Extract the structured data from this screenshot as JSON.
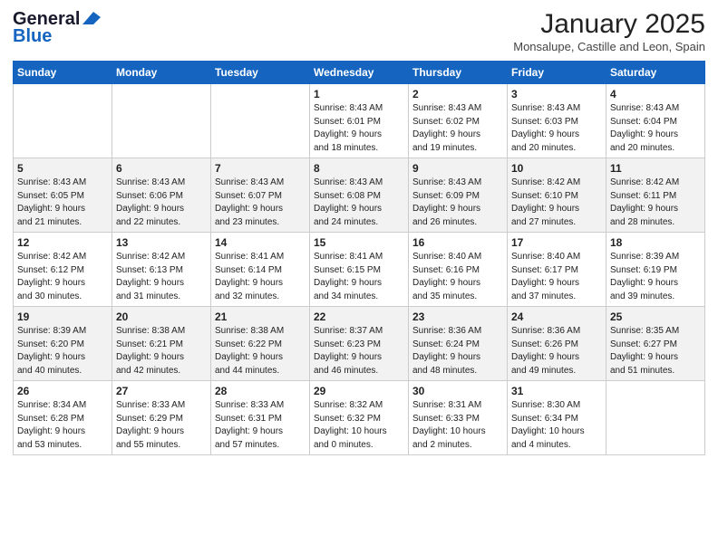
{
  "header": {
    "logo_line1": "General",
    "logo_line2": "Blue",
    "month_year": "January 2025",
    "location": "Monsalupe, Castille and Leon, Spain"
  },
  "days_of_week": [
    "Sunday",
    "Monday",
    "Tuesday",
    "Wednesday",
    "Thursday",
    "Friday",
    "Saturday"
  ],
  "weeks": [
    [
      {
        "day": "",
        "info": ""
      },
      {
        "day": "",
        "info": ""
      },
      {
        "day": "",
        "info": ""
      },
      {
        "day": "1",
        "info": "Sunrise: 8:43 AM\nSunset: 6:01 PM\nDaylight: 9 hours\nand 18 minutes."
      },
      {
        "day": "2",
        "info": "Sunrise: 8:43 AM\nSunset: 6:02 PM\nDaylight: 9 hours\nand 19 minutes."
      },
      {
        "day": "3",
        "info": "Sunrise: 8:43 AM\nSunset: 6:03 PM\nDaylight: 9 hours\nand 20 minutes."
      },
      {
        "day": "4",
        "info": "Sunrise: 8:43 AM\nSunset: 6:04 PM\nDaylight: 9 hours\nand 20 minutes."
      }
    ],
    [
      {
        "day": "5",
        "info": "Sunrise: 8:43 AM\nSunset: 6:05 PM\nDaylight: 9 hours\nand 21 minutes."
      },
      {
        "day": "6",
        "info": "Sunrise: 8:43 AM\nSunset: 6:06 PM\nDaylight: 9 hours\nand 22 minutes."
      },
      {
        "day": "7",
        "info": "Sunrise: 8:43 AM\nSunset: 6:07 PM\nDaylight: 9 hours\nand 23 minutes."
      },
      {
        "day": "8",
        "info": "Sunrise: 8:43 AM\nSunset: 6:08 PM\nDaylight: 9 hours\nand 24 minutes."
      },
      {
        "day": "9",
        "info": "Sunrise: 8:43 AM\nSunset: 6:09 PM\nDaylight: 9 hours\nand 26 minutes."
      },
      {
        "day": "10",
        "info": "Sunrise: 8:42 AM\nSunset: 6:10 PM\nDaylight: 9 hours\nand 27 minutes."
      },
      {
        "day": "11",
        "info": "Sunrise: 8:42 AM\nSunset: 6:11 PM\nDaylight: 9 hours\nand 28 minutes."
      }
    ],
    [
      {
        "day": "12",
        "info": "Sunrise: 8:42 AM\nSunset: 6:12 PM\nDaylight: 9 hours\nand 30 minutes."
      },
      {
        "day": "13",
        "info": "Sunrise: 8:42 AM\nSunset: 6:13 PM\nDaylight: 9 hours\nand 31 minutes."
      },
      {
        "day": "14",
        "info": "Sunrise: 8:41 AM\nSunset: 6:14 PM\nDaylight: 9 hours\nand 32 minutes."
      },
      {
        "day": "15",
        "info": "Sunrise: 8:41 AM\nSunset: 6:15 PM\nDaylight: 9 hours\nand 34 minutes."
      },
      {
        "day": "16",
        "info": "Sunrise: 8:40 AM\nSunset: 6:16 PM\nDaylight: 9 hours\nand 35 minutes."
      },
      {
        "day": "17",
        "info": "Sunrise: 8:40 AM\nSunset: 6:17 PM\nDaylight: 9 hours\nand 37 minutes."
      },
      {
        "day": "18",
        "info": "Sunrise: 8:39 AM\nSunset: 6:19 PM\nDaylight: 9 hours\nand 39 minutes."
      }
    ],
    [
      {
        "day": "19",
        "info": "Sunrise: 8:39 AM\nSunset: 6:20 PM\nDaylight: 9 hours\nand 40 minutes."
      },
      {
        "day": "20",
        "info": "Sunrise: 8:38 AM\nSunset: 6:21 PM\nDaylight: 9 hours\nand 42 minutes."
      },
      {
        "day": "21",
        "info": "Sunrise: 8:38 AM\nSunset: 6:22 PM\nDaylight: 9 hours\nand 44 minutes."
      },
      {
        "day": "22",
        "info": "Sunrise: 8:37 AM\nSunset: 6:23 PM\nDaylight: 9 hours\nand 46 minutes."
      },
      {
        "day": "23",
        "info": "Sunrise: 8:36 AM\nSunset: 6:24 PM\nDaylight: 9 hours\nand 48 minutes."
      },
      {
        "day": "24",
        "info": "Sunrise: 8:36 AM\nSunset: 6:26 PM\nDaylight: 9 hours\nand 49 minutes."
      },
      {
        "day": "25",
        "info": "Sunrise: 8:35 AM\nSunset: 6:27 PM\nDaylight: 9 hours\nand 51 minutes."
      }
    ],
    [
      {
        "day": "26",
        "info": "Sunrise: 8:34 AM\nSunset: 6:28 PM\nDaylight: 9 hours\nand 53 minutes."
      },
      {
        "day": "27",
        "info": "Sunrise: 8:33 AM\nSunset: 6:29 PM\nDaylight: 9 hours\nand 55 minutes."
      },
      {
        "day": "28",
        "info": "Sunrise: 8:33 AM\nSunset: 6:31 PM\nDaylight: 9 hours\nand 57 minutes."
      },
      {
        "day": "29",
        "info": "Sunrise: 8:32 AM\nSunset: 6:32 PM\nDaylight: 10 hours\nand 0 minutes."
      },
      {
        "day": "30",
        "info": "Sunrise: 8:31 AM\nSunset: 6:33 PM\nDaylight: 10 hours\nand 2 minutes."
      },
      {
        "day": "31",
        "info": "Sunrise: 8:30 AM\nSunset: 6:34 PM\nDaylight: 10 hours\nand 4 minutes."
      },
      {
        "day": "",
        "info": ""
      }
    ]
  ]
}
